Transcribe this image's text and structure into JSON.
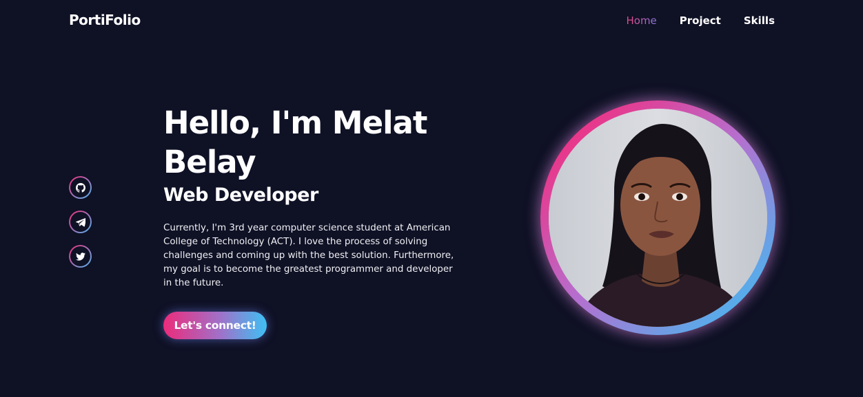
{
  "nav": {
    "brand": "PortiFolio",
    "links": [
      {
        "label": "Home",
        "active": true
      },
      {
        "label": "Project",
        "active": false
      },
      {
        "label": "Skills",
        "active": false
      }
    ]
  },
  "socials": [
    {
      "icon": "github-icon"
    },
    {
      "icon": "telegram-icon"
    },
    {
      "icon": "twitter-icon"
    }
  ],
  "hero": {
    "heading": "Hello, I'm Melat Belay",
    "subheading": "Web Developer",
    "bio": "Currently, I'm 3rd year computer science student at American College of Technology (ACT). I love the process of solving challenges and coming up with the best solution. Furthermore, my goal is to become the greatest programmer and developer in the future.",
    "cta_label": "Let's connect!"
  },
  "profile": {
    "photo": "profile-photo"
  },
  "colors": {
    "background": "#0f1125",
    "gradient_start": "#ec2b7b",
    "gradient_end": "#3ec0f3"
  }
}
